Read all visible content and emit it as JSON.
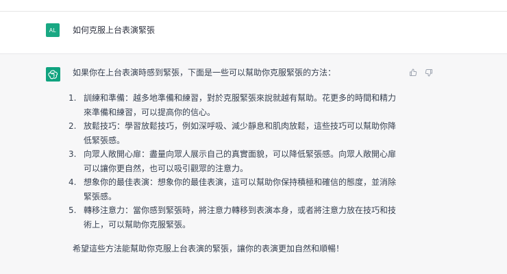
{
  "user_message": {
    "avatar_initials": "AL",
    "text": "如何克服上台表演緊張"
  },
  "assistant_message": {
    "intro": "如果你在上台表演時感到緊張，下面是一些可以幫助你克服緊張的方法：",
    "items": [
      {
        "number": "1.",
        "line1": "訓練和準備：越多地準備和練習，對於克服緊張來說就越有幫助。花更多的時間和精力",
        "line2": "來準備和練習，可以提高你的信心。"
      },
      {
        "number": "2.",
        "line1": "放鬆技巧：學習放鬆技巧，例如深呼吸、減少靜息和肌肉放鬆，這些技巧可以幫助你降",
        "line2": "低緊張感。"
      },
      {
        "number": "3.",
        "line1": "向眾人敞開心扉：盡量向眾人展示自己的真實面貌，可以降低緊張感。向眾人敞開心扉",
        "line2": "可以讓你更自然，也可以吸引觀眾的注意力。"
      },
      {
        "number": "4.",
        "line1": "想象你的最佳表演：想象你的最佳表演，這可以幫助你保持積極和確信的態度，並消除",
        "line2": "緊張感。"
      },
      {
        "number": "5.",
        "line1": "轉移注意力：當你感到緊張時，將注意力轉移到表演本身，或者將注意力放在技巧和技",
        "line2": "術上，可以幫助你克服緊張。"
      }
    ],
    "conclusion": "希望這些方法能幫助你克服上台表演的緊張，讓你的表演更加自然和順暢！"
  },
  "icons": {
    "bot_avatar": "chatgpt-logo-icon",
    "thumbs_up": "thumbs-up-icon",
    "thumbs_down": "thumbs-down-icon"
  },
  "colors": {
    "user_avatar_bg": "#19a883",
    "bot_avatar_bg": "#10a37f",
    "assistant_bg": "#f7f7f8",
    "text": "#374151"
  }
}
